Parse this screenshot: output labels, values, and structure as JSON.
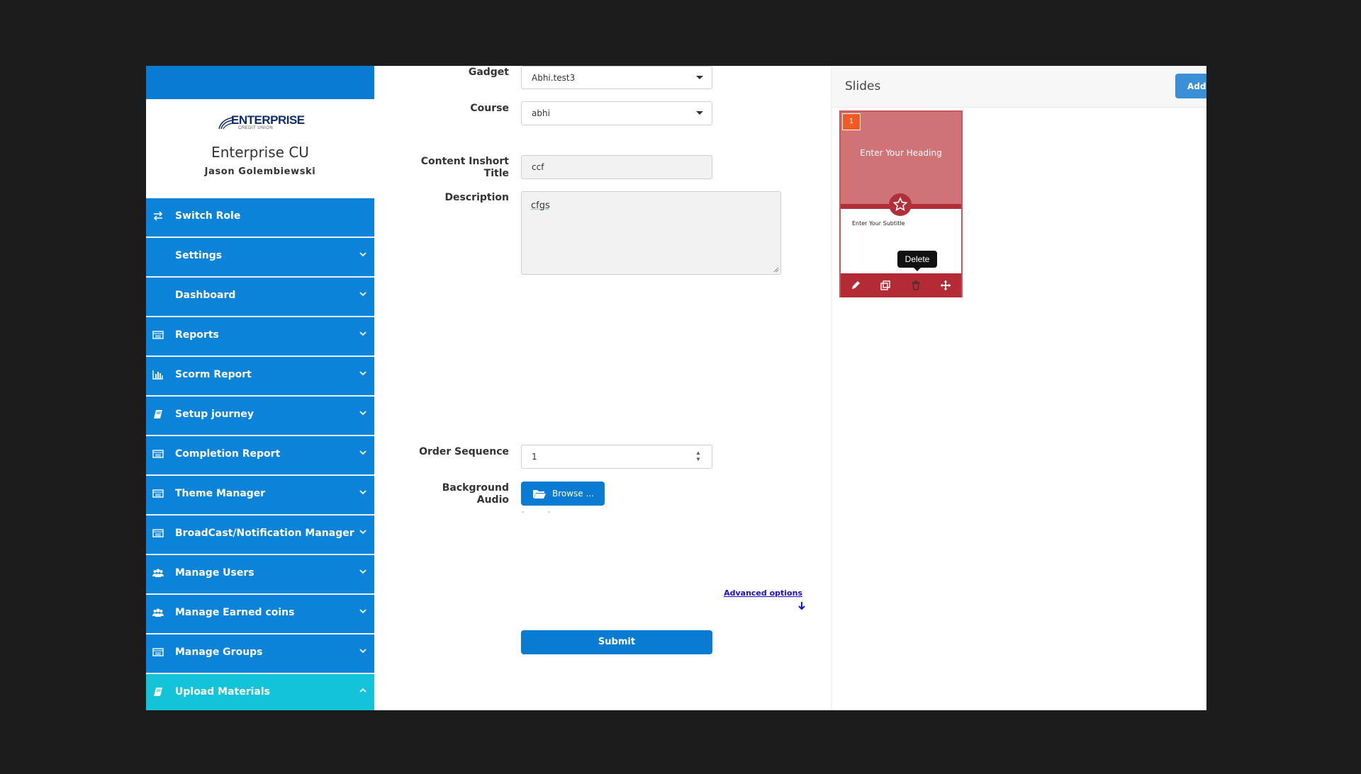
{
  "brand": {
    "logo_text": "ENTERPRISE",
    "logo_sub": "CREDIT UNION",
    "org_name": "Enterprise CU",
    "user_name": "Jason Golembiewski"
  },
  "sidebar": {
    "items": [
      {
        "label": "Switch Role",
        "icon": "switch-arrows-icon",
        "chevron": "none"
      },
      {
        "label": "Settings",
        "icon": "none",
        "chevron": "down"
      },
      {
        "label": "Dashboard",
        "icon": "none",
        "chevron": "down"
      },
      {
        "label": "Reports",
        "icon": "list-window-icon",
        "chevron": "down"
      },
      {
        "label": "Scorm Report",
        "icon": "bar-chart-icon",
        "chevron": "down"
      },
      {
        "label": "Setup journey",
        "icon": "book-icon",
        "chevron": "down"
      },
      {
        "label": "Completion Report",
        "icon": "list-window-icon",
        "chevron": "down"
      },
      {
        "label": "Theme Manager",
        "icon": "list-window-icon",
        "chevron": "down"
      },
      {
        "label": "BroadCast/Notification Manager",
        "icon": "list-window-icon",
        "chevron": "down"
      },
      {
        "label": "Manage Users",
        "icon": "users-icon",
        "chevron": "down"
      },
      {
        "label": "Manage Earned coins",
        "icon": "users-icon",
        "chevron": "down"
      },
      {
        "label": "Manage Groups",
        "icon": "list-window-icon",
        "chevron": "down"
      },
      {
        "label": "Upload Materials",
        "icon": "book-icon",
        "chevron": "up",
        "active": true
      }
    ]
  },
  "form": {
    "gadget_label": "Gadget",
    "gadget_value": "Abhi.test3",
    "course_label": "Course",
    "course_value": "abhi",
    "title_label_1": "Content Inshort",
    "title_label_2": "Title",
    "title_value": "ccf",
    "description_label": "Description",
    "description_value": "cfgs",
    "order_label": "Order Sequence",
    "order_value": "1",
    "audio_label_1": "Background",
    "audio_label_2": "Audio",
    "browse_label": "Browse ...",
    "advanced_label": "Advanced options",
    "submit_label": "Submit"
  },
  "slides": {
    "title": "Slides",
    "add_label": "Add Slide",
    "card": {
      "number": "1",
      "heading": "Enter Your Heading",
      "subtitle": "Enter Your Subtitle",
      "tooltip": "Delete"
    }
  },
  "colors": {
    "primary": "#0a83d8",
    "active_menu": "#13c3d8",
    "slide_top": "#cf7377",
    "slide_dark": "#b02f38",
    "badge": "#f15a22"
  }
}
